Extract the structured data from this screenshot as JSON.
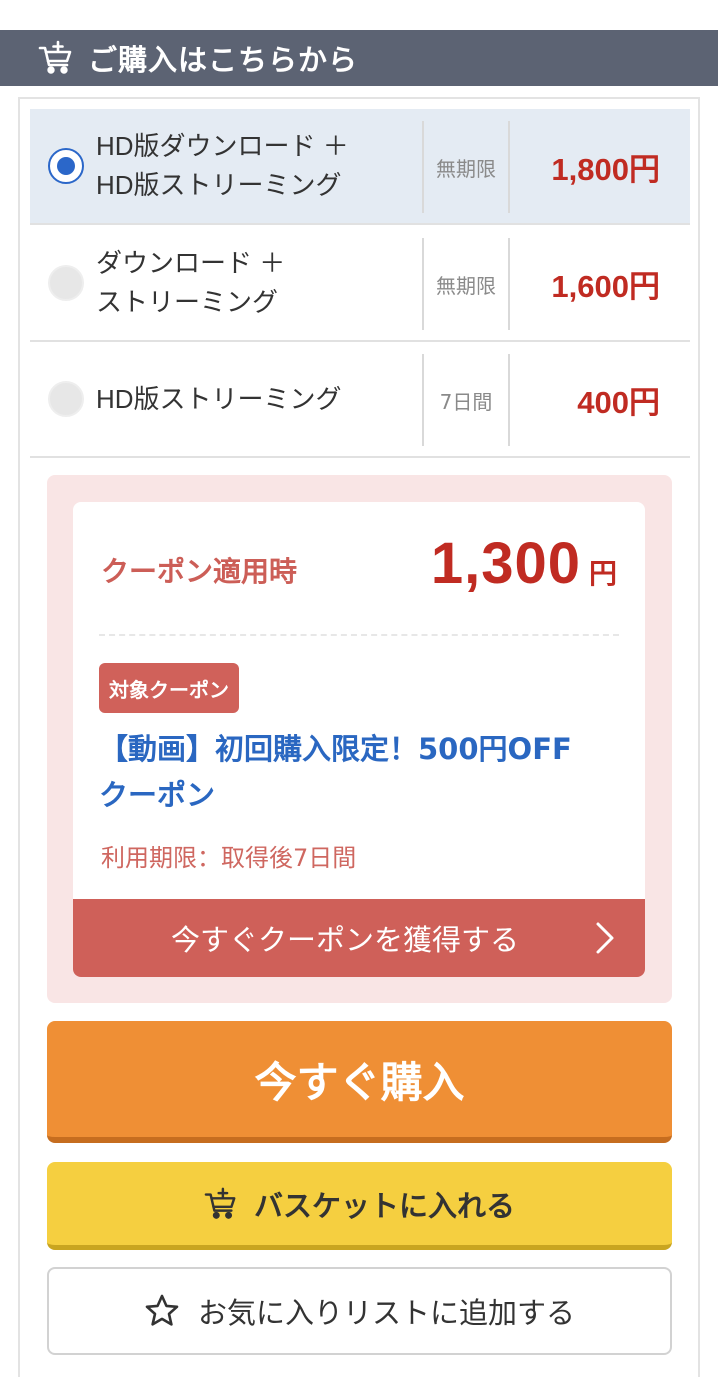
{
  "header": {
    "title": "ご購入はこちらから",
    "icon": "cart-add-icon"
  },
  "options": [
    {
      "name_line1": "HD版ダウンロード ＋",
      "name_line2": "HD版ストリーミング",
      "period": "無期限",
      "price": "1,800円",
      "selected": true
    },
    {
      "name_line1": "ダウンロード ＋",
      "name_line2": "ストリーミング",
      "period": "無期限",
      "price": "1,600円",
      "selected": false
    },
    {
      "name_line1": "HD版ストリーミング",
      "name_line2": "",
      "period": "7日間",
      "price": "400円",
      "selected": false
    }
  ],
  "coupon": {
    "label": "クーポン適用時",
    "price": "1,300",
    "yen": "円",
    "badge": "対象クーポン",
    "name_line1": "【動画】初回購入限定！500円OFF",
    "name_line2": "クーポン",
    "expiry": "利用期限：取得後7日間",
    "get_button": "今すぐクーポンを獲得する"
  },
  "buttons": {
    "buy": "今すぐ購入",
    "basket": "バスケットに入れる",
    "favorite": "お気に入りリストに追加する"
  },
  "colors": {
    "header_bg": "#5c6373",
    "price_red": "#c02b22",
    "selected_bg": "#e4ebf3",
    "radio_blue": "#2b67c9",
    "coupon_bg": "#f9e5e5",
    "coupon_red": "#cf6059",
    "coupon_blue": "#2a67c1",
    "buy_orange": "#ef8f35",
    "basket_yellow": "#f5cf40"
  }
}
